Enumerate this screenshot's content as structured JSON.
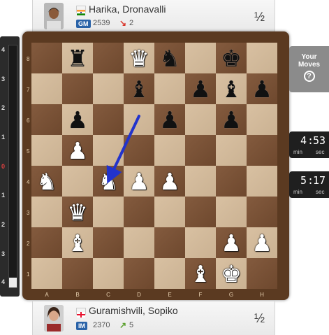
{
  "top_player": {
    "name": "Harika, Dronavalli",
    "title": "GM",
    "rating": "2539",
    "change": "2",
    "trend": "down",
    "result": "½",
    "flag_colors": [
      "#ff9933",
      "#ffffff",
      "#138808"
    ]
  },
  "bottom_player": {
    "name": "Guramishvili, Sopiko",
    "title": "IM",
    "rating": "2370",
    "change": "5",
    "trend": "up",
    "result": "½",
    "flag_colors": [
      "#ffffff",
      "#e8112d"
    ]
  },
  "eval_bar": {
    "labels_top": [
      "4",
      "3",
      "2",
      "1"
    ],
    "zero_label": "0",
    "labels_bottom": [
      "1",
      "2",
      "3",
      "4"
    ],
    "white_fraction": 0.04
  },
  "board": {
    "files": [
      "A",
      "B",
      "C",
      "D",
      "E",
      "F",
      "G",
      "H"
    ],
    "ranks": [
      "8",
      "7",
      "6",
      "5",
      "4",
      "3",
      "2",
      "1"
    ],
    "pieces": [
      {
        "square": "b8",
        "color": "b",
        "type": "rook",
        "glyph": "♜"
      },
      {
        "square": "d8",
        "color": "w",
        "type": "queen",
        "glyph": "♛"
      },
      {
        "square": "e8",
        "color": "b",
        "type": "knight",
        "glyph": "♞"
      },
      {
        "square": "g8",
        "color": "b",
        "type": "king",
        "glyph": "♚"
      },
      {
        "square": "d7",
        "color": "b",
        "type": "bishop",
        "glyph": "♝"
      },
      {
        "square": "f7",
        "color": "b",
        "type": "pawn",
        "glyph": "♟"
      },
      {
        "square": "g7",
        "color": "b",
        "type": "bishop",
        "glyph": "♝"
      },
      {
        "square": "h7",
        "color": "b",
        "type": "pawn",
        "glyph": "♟"
      },
      {
        "square": "b6",
        "color": "b",
        "type": "pawn",
        "glyph": "♟"
      },
      {
        "square": "e6",
        "color": "b",
        "type": "pawn",
        "glyph": "♟"
      },
      {
        "square": "g6",
        "color": "b",
        "type": "pawn",
        "glyph": "♟"
      },
      {
        "square": "b5",
        "color": "w",
        "type": "pawn",
        "glyph": "♟"
      },
      {
        "square": "a4",
        "color": "w",
        "type": "knight",
        "glyph": "♞"
      },
      {
        "square": "c4",
        "color": "w",
        "type": "knight",
        "glyph": "♞"
      },
      {
        "square": "d4",
        "color": "w",
        "type": "pawn",
        "glyph": "♟"
      },
      {
        "square": "e4",
        "color": "w",
        "type": "pawn",
        "glyph": "♟"
      },
      {
        "square": "b3",
        "color": "w",
        "type": "queen",
        "glyph": "♛"
      },
      {
        "square": "b2",
        "color": "w",
        "type": "bishop",
        "glyph": "♝"
      },
      {
        "square": "g2",
        "color": "w",
        "type": "pawn",
        "glyph": "♟"
      },
      {
        "square": "h2",
        "color": "w",
        "type": "pawn",
        "glyph": "♟"
      },
      {
        "square": "f1",
        "color": "w",
        "type": "bishop",
        "glyph": "♝"
      },
      {
        "square": "g1",
        "color": "w",
        "type": "king",
        "glyph": "♚"
      }
    ],
    "arrow": {
      "from": "d6",
      "to": "c4",
      "color": "#2233cc"
    }
  },
  "your_moves": {
    "line1": "Your",
    "line2": "Moves",
    "help_glyph": "?"
  },
  "clock_top": {
    "minutes": "4",
    "seconds": "53",
    "min_label": "min",
    "sec_label": "sec"
  },
  "clock_bottom": {
    "minutes": "5",
    "seconds": "17",
    "min_label": "min",
    "sec_label": "sec"
  }
}
